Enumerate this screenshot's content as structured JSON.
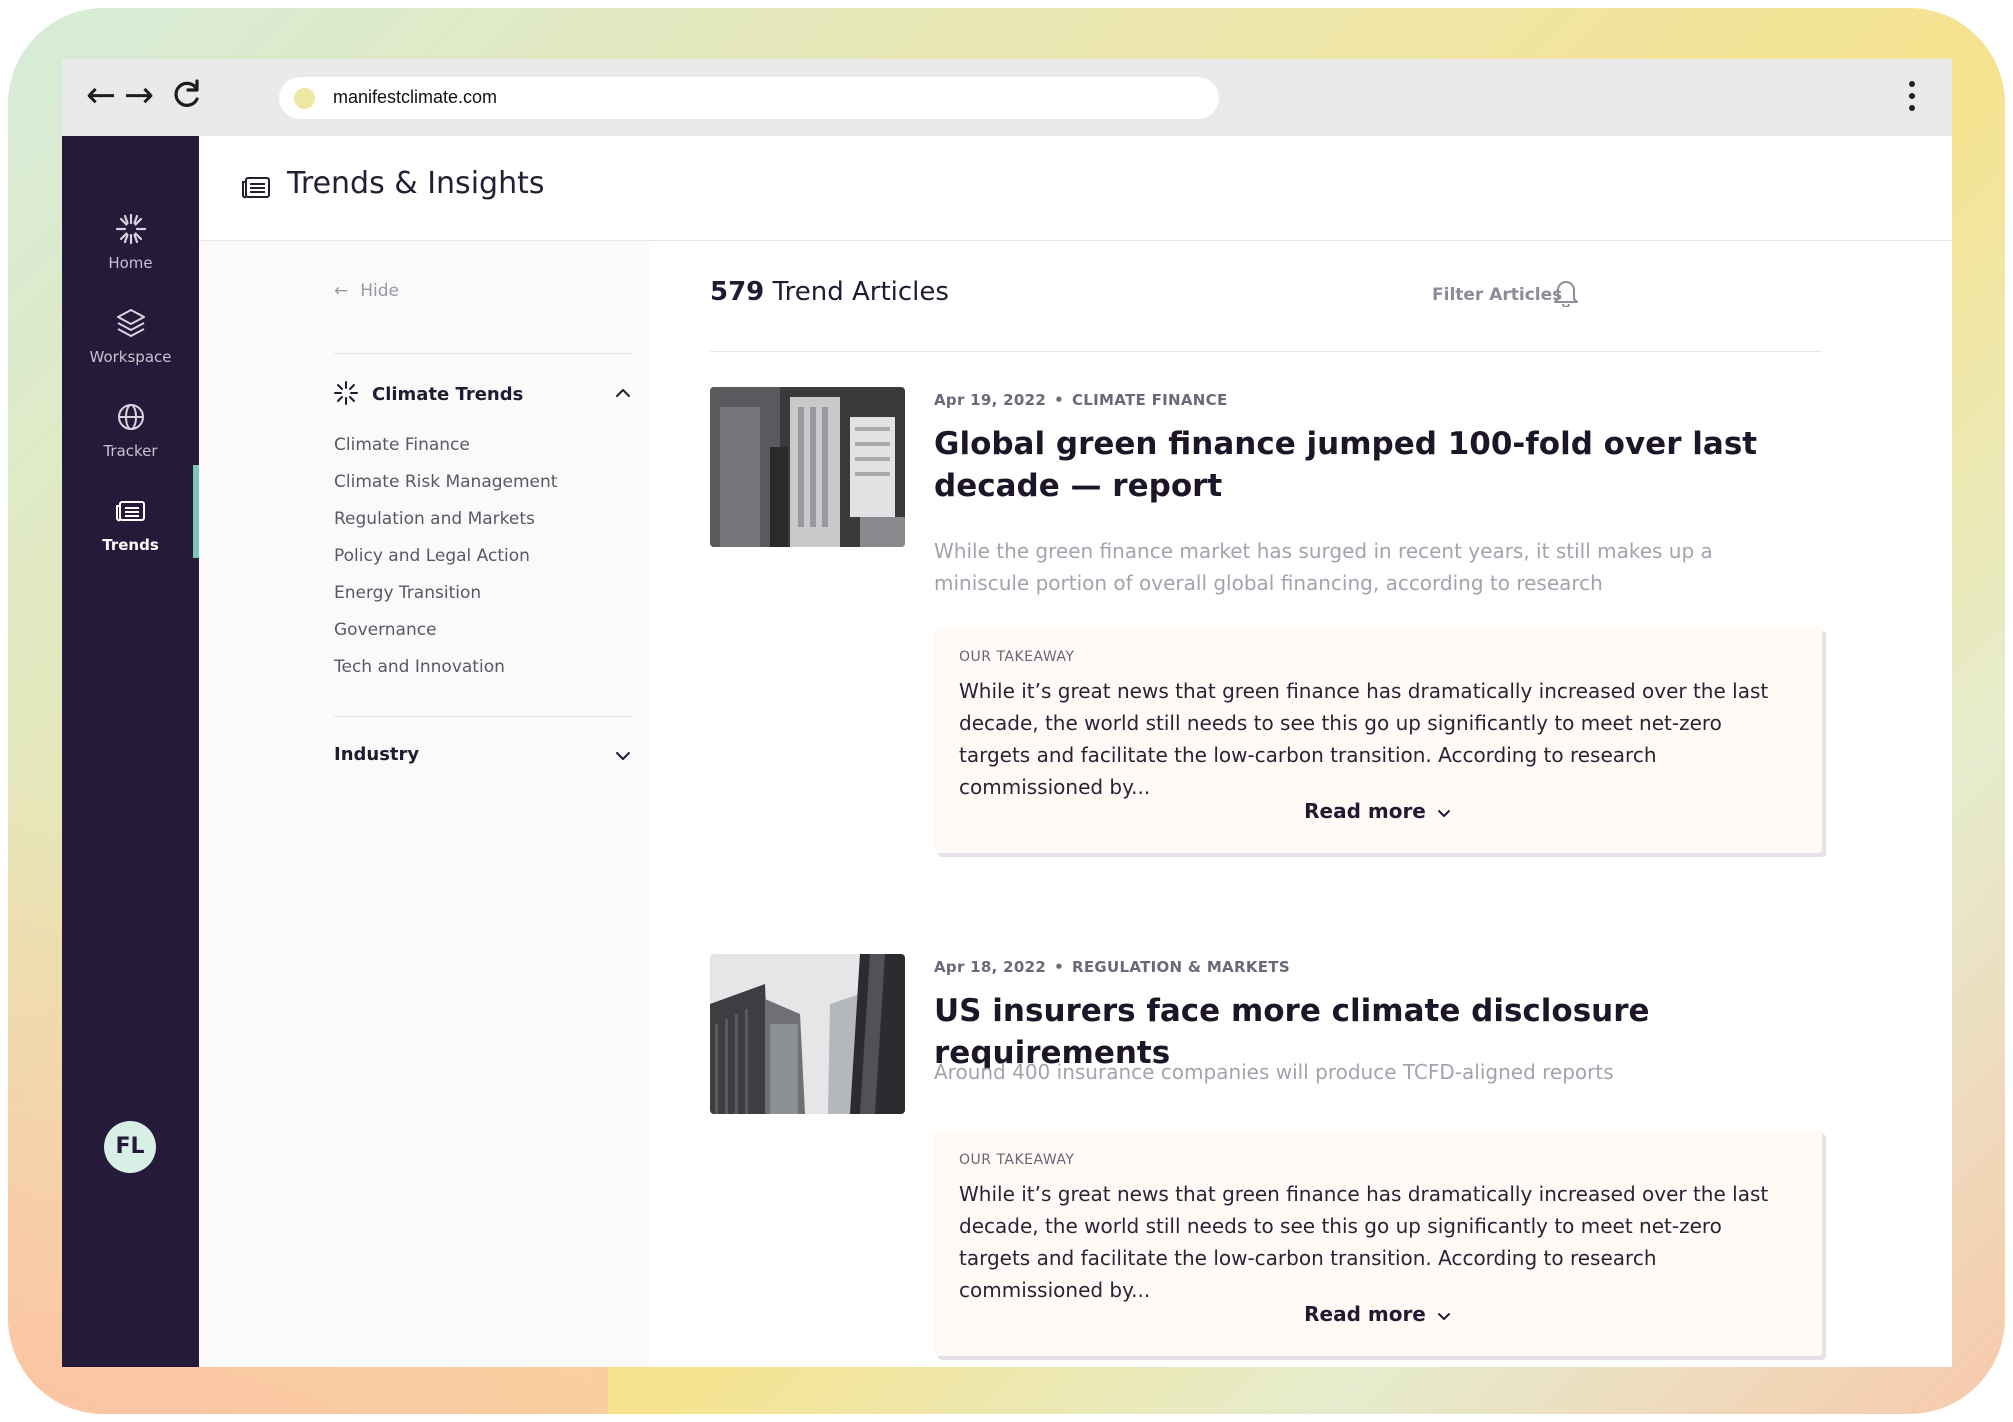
{
  "browser": {
    "back_glyph": "←",
    "forward_glyph": "→",
    "reload_glyph": "⟳",
    "url": "manifestclimate.com"
  },
  "sidebar": {
    "items": [
      {
        "label": "Home",
        "icon": "sun-burst-icon"
      },
      {
        "label": "Workspace",
        "icon": "layers-icon"
      },
      {
        "label": "Tracker",
        "icon": "globe-icon"
      },
      {
        "label": "Trends",
        "icon": "newspaper-icon"
      }
    ],
    "active": "Trends",
    "avatar_initials": "FL"
  },
  "header": {
    "title": "Trends & Insights"
  },
  "filters": {
    "hide_label": "Hide",
    "climate_trends_label": "Climate Trends",
    "topics": [
      "Climate Finance",
      "Climate Risk Management",
      "Regulation and Markets",
      "Policy and Legal Action",
      "Energy Transition",
      "Governance",
      "Tech and Innovation"
    ],
    "industry_label": "Industry"
  },
  "content": {
    "count": "579",
    "count_label": "Trend Articles",
    "filter_label": "Filter Articles",
    "articles": [
      {
        "date": "Apr 19, 2022",
        "category": "CLIMATE FINANCE",
        "title": "Global green finance jumped 100-fold over last decade — report",
        "summary": "While the green finance market has surged in recent years, it still makes up a miniscule portion of overall global financing, according to research",
        "takeaway_label": "OUR TAKEAWAY",
        "takeaway": "While it’s great news that green finance has dramatically increased over the last decade, the world still needs to see this go up significantly to meet net-zero targets and facilitate the low-carbon transition. According to research commissioned by...",
        "read_more": "Read more"
      },
      {
        "date": "Apr 18, 2022",
        "category": "REGULATION & MARKETS",
        "title": "US insurers face more climate disclosure requirements",
        "summary": "Around 400 insurance companies will produce TCFD-aligned reports",
        "takeaway_label": "OUR TAKEAWAY",
        "takeaway": "While it’s great news that green finance has dramatically increased over the last decade, the world still needs to see this go up significantly to meet net-zero targets and facilitate the low-carbon transition. According to research commissioned by...",
        "read_more": "Read more"
      }
    ]
  },
  "colors": {
    "sidebar_bg": "#251a3a",
    "active_indicator": "#7ac6b8",
    "takeaway_bg": "#fffaf5"
  }
}
